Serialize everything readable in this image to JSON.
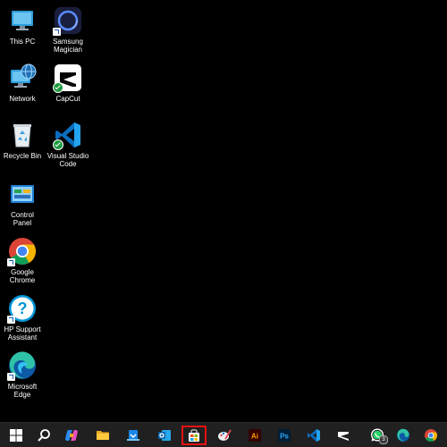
{
  "desktop": {
    "icons": [
      {
        "label": "This PC",
        "icon": "this-pc-icon"
      },
      {
        "label": "Samsung\nMagician",
        "icon": "samsung-magician-icon"
      },
      {
        "label": "Network",
        "icon": "network-icon"
      },
      {
        "label": "CapCut",
        "icon": "capcut-icon"
      },
      {
        "label": "Recycle Bin",
        "icon": "recycle-bin-icon"
      },
      {
        "label": "Visual Studio\nCode",
        "icon": "vscode-icon"
      },
      {
        "label": "Control\nPanel",
        "icon": "control-panel-icon"
      },
      {
        "label": "Google\nChrome",
        "icon": "chrome-icon"
      },
      {
        "label": "HP Support\nAssistant",
        "icon": "hp-support-icon"
      },
      {
        "label": "Microsoft\nEdge",
        "icon": "edge-icon"
      }
    ]
  },
  "taskbar": {
    "items": [
      {
        "name": "start",
        "icon": "windows-start-icon"
      },
      {
        "name": "search",
        "icon": "search-icon"
      },
      {
        "name": "copilot",
        "icon": "copilot-icon"
      },
      {
        "name": "file-explorer",
        "icon": "folder-icon"
      },
      {
        "name": "app-installer",
        "icon": "app-installer-icon"
      },
      {
        "name": "outlook",
        "icon": "outlook-icon"
      },
      {
        "name": "microsoft-store",
        "icon": "store-icon",
        "active": true
      },
      {
        "name": "paint",
        "icon": "paint-icon"
      },
      {
        "name": "adobe-illustrator",
        "icon": "illustrator-icon",
        "text": "Ai"
      },
      {
        "name": "adobe-photoshop",
        "icon": "photoshop-icon",
        "text": "Ps"
      },
      {
        "name": "vscode",
        "icon": "vscode-icon"
      },
      {
        "name": "capcut",
        "icon": "capcut-icon"
      },
      {
        "name": "whatsapp",
        "icon": "whatsapp-icon",
        "badge": "3"
      },
      {
        "name": "edge",
        "icon": "edge-icon"
      },
      {
        "name": "chrome",
        "icon": "chrome-icon"
      }
    ]
  },
  "colors": {
    "taskbar_bg": "#202020",
    "active_outline": "#e11111",
    "desktop_bg": "#000000"
  }
}
